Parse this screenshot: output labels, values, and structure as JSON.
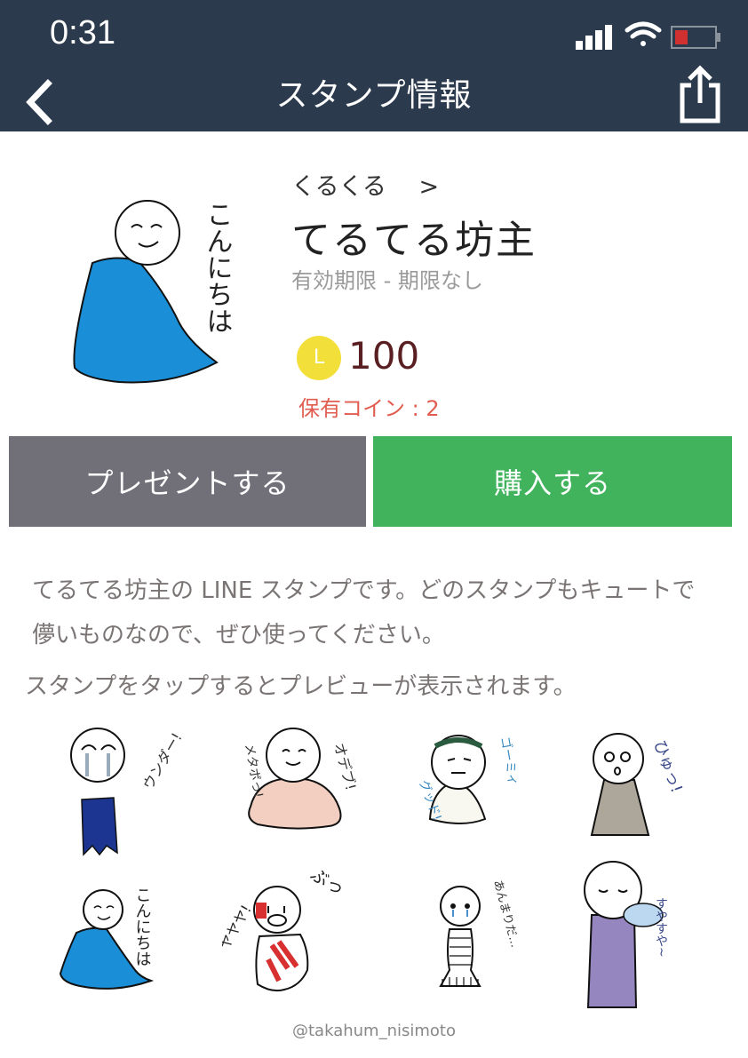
{
  "status_bar": {
    "time": "0:31"
  },
  "nav": {
    "title": "スタンプ情報"
  },
  "product": {
    "author": "くるくる",
    "author_chevron": ">",
    "title": "てるてる坊主",
    "validity": "有効期限 - 期限なし",
    "coin_symbol": "L",
    "price": "100",
    "owned_coins": "保有コイン : 2"
  },
  "actions": {
    "gift_label": "プレゼントする",
    "buy_label": "購入する"
  },
  "description": {
    "line1": "てるてる坊主の LINE スタンプです。どのスタンプもキュートで",
    "line2": "儚いものなので、ぜひ使ってください。",
    "hint": "スタンプをタップするとプレビューが表示されます。"
  },
  "sticker_texts": {
    "main": "こんにちは",
    "s1": "ウンダー!",
    "s2a": "オデブ!",
    "s2b": "メタボっ!",
    "s3a": "ゴーミィ",
    "s3b": "グッド!",
    "s4": "ひゅっ!",
    "s5": "こんにちは",
    "s6a": "ぶっ",
    "s6b": "ヤヤヤ!",
    "s7": "あんまりだ…",
    "s8": "すやすや~"
  },
  "colors": {
    "header_bg": "#2b3a4c",
    "gift_btn": "#717079",
    "buy_btn": "#41b35c",
    "coin": "#f2df3a",
    "price": "#5a1f22",
    "owned": "#e15d50",
    "sticker_blue": "#1a8fd8"
  },
  "credit": "@takahum_nisimoto"
}
